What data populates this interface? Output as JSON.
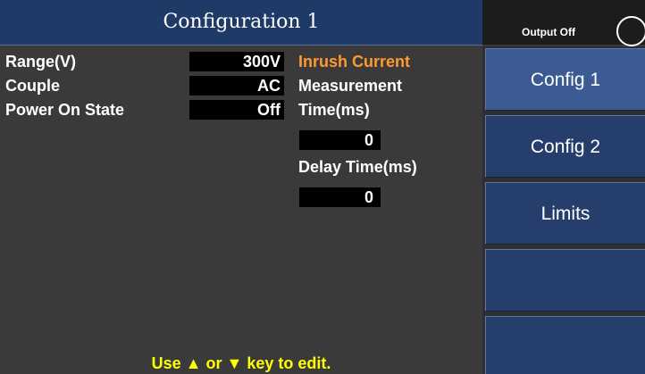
{
  "header": {
    "title": "Configuration 1"
  },
  "status": {
    "output_label": "Output Off",
    "indicator_icon": "circle-outline"
  },
  "params": {
    "range": {
      "label": "Range(V)",
      "value": "300V"
    },
    "couple": {
      "label": "Couple",
      "value": "AC"
    },
    "power_on_state": {
      "label": "Power On State",
      "value": "Off"
    }
  },
  "inrush": {
    "title": "Inrush Current",
    "measurement_label": "Measurement",
    "time_label": "Time(ms)",
    "time_value": "0",
    "delay_label": "Delay Time(ms)",
    "delay_value": "0"
  },
  "softkeys": [
    {
      "label": "Config 1"
    },
    {
      "label": "Config 2"
    },
    {
      "label": "Limits"
    },
    {
      "label": ""
    },
    {
      "label": ""
    }
  ],
  "hint": {
    "prefix": "Use",
    "up_arrow": "▲",
    "or": "or",
    "down_arrow": "▼",
    "suffix": "key to edit."
  },
  "colors": {
    "title_bar": "#203a68",
    "softkey": "#263e6c",
    "softkey_active": "#3c5b93",
    "background": "#3a3a3a",
    "accent_orange": "#ff9933",
    "hint_yellow": "#ffff00"
  }
}
